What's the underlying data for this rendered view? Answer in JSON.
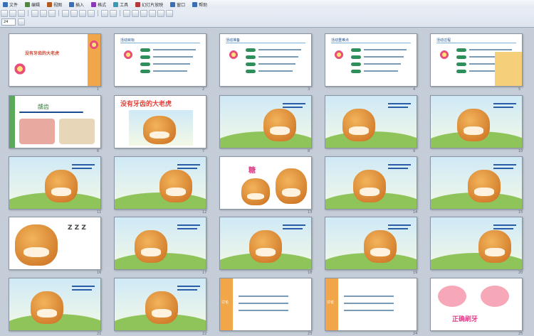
{
  "menu": {
    "items": [
      {
        "label": "文件",
        "color": "#3a6fb8"
      },
      {
        "label": "编辑",
        "color": "#4f8a3a"
      },
      {
        "label": "视图",
        "color": "#b55a1e"
      },
      {
        "label": "插入",
        "color": "#3a6fb8"
      },
      {
        "label": "格式",
        "color": "#8a3ab5"
      },
      {
        "label": "工具",
        "color": "#3a9ab5"
      },
      {
        "label": "幻灯片放映",
        "color": "#b53a3a"
      },
      {
        "label": "窗口",
        "color": "#3a6fb8"
      },
      {
        "label": "帮助",
        "color": "#3a6fb8"
      }
    ]
  },
  "toolbar": {
    "zoom_value": "24"
  },
  "slides": [
    {
      "num": "1",
      "kind": "cover",
      "title": "没有牙齿的大老虎"
    },
    {
      "num": "2",
      "kind": "list",
      "title": "活动目标"
    },
    {
      "num": "3",
      "kind": "list",
      "title": "活动准备"
    },
    {
      "num": "4",
      "kind": "list",
      "title": "活动重难点"
    },
    {
      "num": "5",
      "kind": "process",
      "title": "活动过程"
    },
    {
      "num": "6",
      "kind": "decay",
      "title": "龋齿"
    },
    {
      "num": "7",
      "kind": "titleimg",
      "title": "没有牙齿的大老虎"
    },
    {
      "num": "8",
      "kind": "story",
      "title": ""
    },
    {
      "num": "9",
      "kind": "story",
      "title": ""
    },
    {
      "num": "10",
      "kind": "story",
      "title": ""
    },
    {
      "num": "11",
      "kind": "story",
      "title": ""
    },
    {
      "num": "12",
      "kind": "story",
      "title": ""
    },
    {
      "num": "13",
      "kind": "candy",
      "title": "糖"
    },
    {
      "num": "14",
      "kind": "story",
      "title": ""
    },
    {
      "num": "15",
      "kind": "story",
      "title": ""
    },
    {
      "num": "16",
      "kind": "sleep",
      "title": "Z Z Z"
    },
    {
      "num": "17",
      "kind": "story",
      "title": ""
    },
    {
      "num": "18",
      "kind": "story",
      "title": ""
    },
    {
      "num": "19",
      "kind": "story",
      "title": ""
    },
    {
      "num": "20",
      "kind": "story",
      "title": ""
    },
    {
      "num": "21",
      "kind": "story",
      "title": ""
    },
    {
      "num": "22",
      "kind": "story",
      "title": ""
    },
    {
      "num": "23",
      "kind": "q",
      "title": "讨论"
    },
    {
      "num": "24",
      "kind": "q",
      "title": "讨论"
    },
    {
      "num": "25",
      "kind": "teeth",
      "title": "正确刷牙"
    }
  ],
  "colors": {
    "background": "#c4cdd8",
    "accent": "#e0413a",
    "title_blue": "#1a4c8a"
  }
}
